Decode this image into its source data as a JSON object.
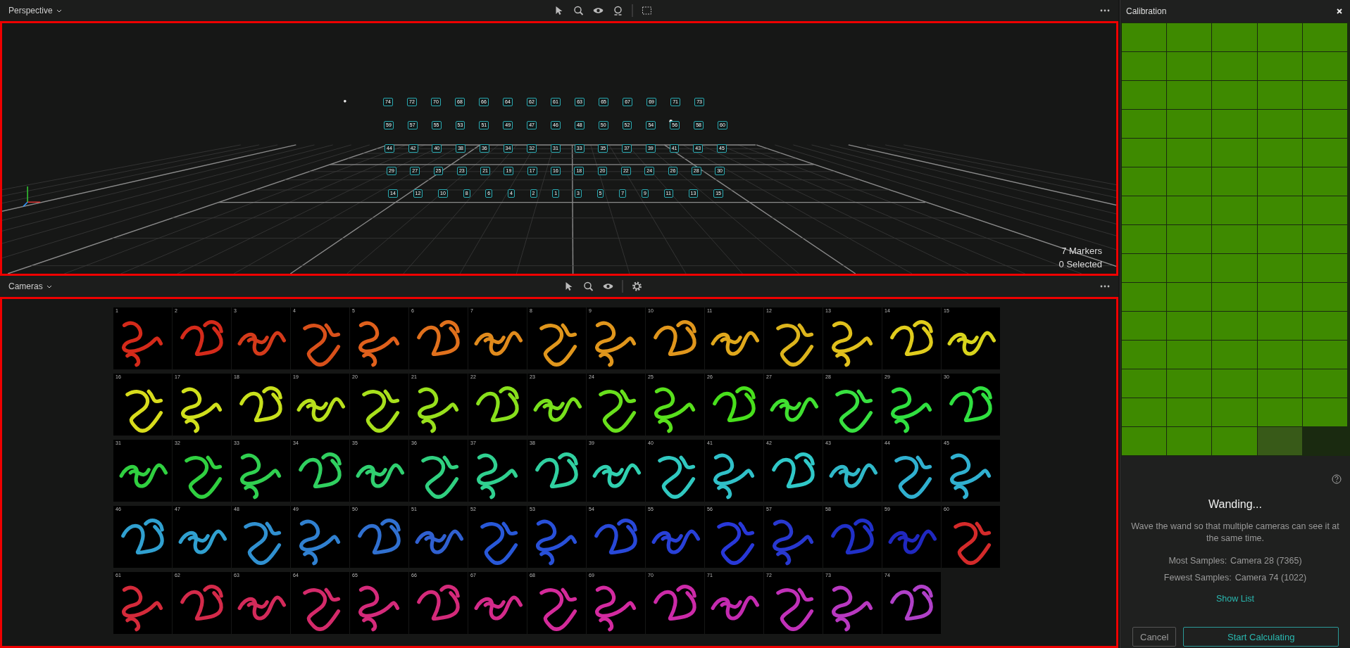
{
  "perspective": {
    "title": "Perspective",
    "marker_rows": [
      [
        "74",
        "72",
        "70",
        "68",
        "66",
        "64",
        "62",
        "61",
        "63",
        "65",
        "67",
        "69",
        "71",
        "73"
      ],
      [
        "59",
        "57",
        "55",
        "53",
        "51",
        "49",
        "47",
        "46",
        "48",
        "50",
        "52",
        "54",
        "56",
        "58",
        "60"
      ],
      [
        "44",
        "42",
        "40",
        "38",
        "36",
        "34",
        "32",
        "31",
        "33",
        "35",
        "37",
        "39",
        "41",
        "43",
        "45"
      ],
      [
        "29",
        "27",
        "25",
        "23",
        "21",
        "19",
        "17",
        "16",
        "18",
        "20",
        "22",
        "24",
        "26",
        "28",
        "30"
      ],
      [
        "14",
        "12",
        "10",
        "8",
        "6",
        "4",
        "2",
        "1",
        "3",
        "5",
        "7",
        "9",
        "11",
        "13",
        "15"
      ]
    ],
    "marker_count": "7 Markers",
    "selected_count": "0 Selected"
  },
  "cameras": {
    "title": "Cameras",
    "rows": [
      [
        {
          "number": "1",
          "color": "#d42a1a"
        },
        {
          "number": "2",
          "color": "#d42a1a"
        },
        {
          "number": "3",
          "color": "#d43a1a"
        },
        {
          "number": "4",
          "color": "#d8501a"
        },
        {
          "number": "5",
          "color": "#e0601c"
        },
        {
          "number": "6",
          "color": "#e0701c"
        },
        {
          "number": "7",
          "color": "#e08a1c"
        },
        {
          "number": "8",
          "color": "#e0961c"
        },
        {
          "number": "9",
          "color": "#e0961c"
        },
        {
          "number": "10",
          "color": "#e0961c"
        },
        {
          "number": "11",
          "color": "#e0a81c"
        },
        {
          "number": "12",
          "color": "#dcb41c"
        },
        {
          "number": "13",
          "color": "#e0c01c"
        },
        {
          "number": "14",
          "color": "#e0cc1c"
        },
        {
          "number": "15",
          "color": "#d8d41c"
        }
      ],
      [
        {
          "number": "16",
          "color": "#d8dc1c"
        },
        {
          "number": "17",
          "color": "#d0e01c"
        },
        {
          "number": "18",
          "color": "#c8e01c"
        },
        {
          "number": "19",
          "color": "#b8e01c"
        },
        {
          "number": "20",
          "color": "#a8e01c"
        },
        {
          "number": "21",
          "color": "#98e01c"
        },
        {
          "number": "22",
          "color": "#88e01c"
        },
        {
          "number": "23",
          "color": "#78e01c"
        },
        {
          "number": "24",
          "color": "#68e01c"
        },
        {
          "number": "25",
          "color": "#58e01c"
        },
        {
          "number": "26",
          "color": "#48e01c"
        },
        {
          "number": "27",
          "color": "#40e030"
        },
        {
          "number": "28",
          "color": "#38e040"
        },
        {
          "number": "29",
          "color": "#30e040"
        },
        {
          "number": "30",
          "color": "#30e040"
        }
      ],
      [
        {
          "number": "31",
          "color": "#30d040"
        },
        {
          "number": "32",
          "color": "#30d040"
        },
        {
          "number": "33",
          "color": "#30d050"
        },
        {
          "number": "34",
          "color": "#30d060"
        },
        {
          "number": "35",
          "color": "#30d070"
        },
        {
          "number": "36",
          "color": "#30d080"
        },
        {
          "number": "37",
          "color": "#30d090"
        },
        {
          "number": "38",
          "color": "#30d0a0"
        },
        {
          "number": "39",
          "color": "#30d0b0"
        },
        {
          "number": "40",
          "color": "#30c8c0"
        },
        {
          "number": "41",
          "color": "#30c0c8"
        },
        {
          "number": "42",
          "color": "#30c8c8"
        },
        {
          "number": "43",
          "color": "#30b8c8"
        },
        {
          "number": "44",
          "color": "#30b0d0"
        },
        {
          "number": "45",
          "color": "#30b0d0"
        }
      ],
      [
        {
          "number": "46",
          "color": "#30a0d0"
        },
        {
          "number": "47",
          "color": "#30a0d0"
        },
        {
          "number": "48",
          "color": "#3090d0"
        },
        {
          "number": "49",
          "color": "#3080d0"
        },
        {
          "number": "50",
          "color": "#3070d0"
        },
        {
          "number": "51",
          "color": "#3060d0"
        },
        {
          "number": "52",
          "color": "#2858d8"
        },
        {
          "number": "53",
          "color": "#2850d8"
        },
        {
          "number": "54",
          "color": "#2848d8"
        },
        {
          "number": "55",
          "color": "#2840d8"
        },
        {
          "number": "56",
          "color": "#2838d8"
        },
        {
          "number": "57",
          "color": "#2838d0"
        },
        {
          "number": "58",
          "color": "#2030c8"
        },
        {
          "number": "59",
          "color": "#2028c0"
        },
        {
          "number": "60",
          "color": "#d42a2a"
        }
      ],
      [
        {
          "number": "61",
          "color": "#d42a3a"
        },
        {
          "number": "62",
          "color": "#d42a4a"
        },
        {
          "number": "63",
          "color": "#d42a5a"
        },
        {
          "number": "64",
          "color": "#d42a6a"
        },
        {
          "number": "65",
          "color": "#d42a7a"
        },
        {
          "number": "66",
          "color": "#d42a7a"
        },
        {
          "number": "67",
          "color": "#d42a8a"
        },
        {
          "number": "68",
          "color": "#d42a9a"
        },
        {
          "number": "69",
          "color": "#d42aa0"
        },
        {
          "number": "70",
          "color": "#cc2aa8"
        },
        {
          "number": "71",
          "color": "#c42ab0"
        },
        {
          "number": "72",
          "color": "#c030b8"
        },
        {
          "number": "73",
          "color": "#b838c0"
        },
        {
          "number": "74",
          "color": "#b040c8"
        }
      ]
    ]
  },
  "calibration": {
    "title": "Calibration",
    "cells": [
      {
        "done": true
      },
      {
        "done": true
      },
      {
        "done": true
      },
      {
        "done": true
      },
      {
        "done": true
      },
      {
        "done": true
      },
      {
        "done": true
      },
      {
        "done": true
      },
      {
        "done": true
      },
      {
        "done": true
      },
      {
        "done": true
      },
      {
        "done": true
      },
      {
        "done": true
      },
      {
        "done": true
      },
      {
        "done": true
      },
      {
        "done": true
      },
      {
        "done": true
      },
      {
        "done": true
      },
      {
        "done": true
      },
      {
        "done": true
      },
      {
        "done": true
      },
      {
        "done": true
      },
      {
        "done": true
      },
      {
        "done": true
      },
      {
        "done": true
      },
      {
        "done": true
      },
      {
        "done": true
      },
      {
        "done": true
      },
      {
        "done": true
      },
      {
        "done": true
      },
      {
        "done": true
      },
      {
        "done": true
      },
      {
        "done": true
      },
      {
        "done": true
      },
      {
        "done": true
      },
      {
        "done": true
      },
      {
        "done": true
      },
      {
        "done": true
      },
      {
        "done": true
      },
      {
        "done": true
      },
      {
        "done": true
      },
      {
        "done": true
      },
      {
        "done": true
      },
      {
        "done": true
      },
      {
        "done": true
      },
      {
        "done": true
      },
      {
        "done": true
      },
      {
        "done": true
      },
      {
        "done": true
      },
      {
        "done": true
      },
      {
        "done": true
      },
      {
        "done": true
      },
      {
        "done": true
      },
      {
        "done": true
      },
      {
        "done": true
      },
      {
        "done": true
      },
      {
        "done": true
      },
      {
        "done": true
      },
      {
        "done": true
      },
      {
        "done": true
      },
      {
        "done": true
      },
      {
        "done": true
      },
      {
        "done": true
      },
      {
        "done": true
      },
      {
        "done": true
      },
      {
        "done": true
      },
      {
        "done": true
      },
      {
        "done": true
      },
      {
        "done": true
      },
      {
        "done": true
      },
      {
        "done": true
      },
      {
        "done": true
      },
      {
        "done": true
      },
      {
        "done": false
      }
    ],
    "status": "Wanding...",
    "description": "Wave the wand so that multiple cameras can see it at the same time.",
    "most_samples_label": "Most Samples:",
    "most_samples_value": "Camera 28 (7365)",
    "fewest_samples_label": "Fewest Samples:",
    "fewest_samples_value": "Camera 74 (1022)",
    "show_list": "Show List",
    "buttons": [
      "Cancel",
      "Start Calculating"
    ]
  }
}
